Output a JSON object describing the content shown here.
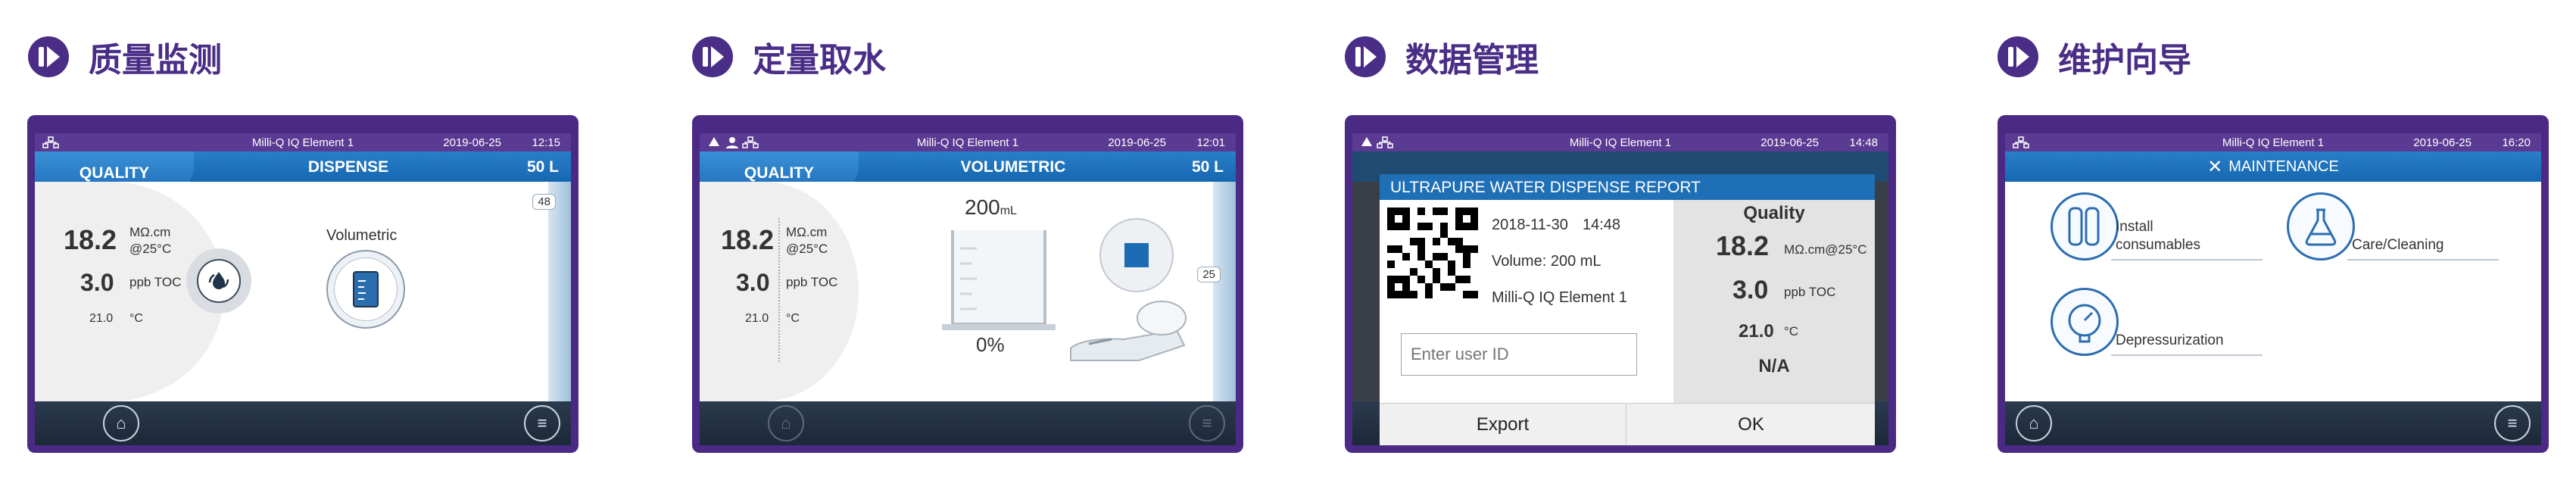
{
  "sections": [
    {
      "title": "质量监测"
    },
    {
      "title": "定量取水"
    },
    {
      "title": "数据管理"
    },
    {
      "title": "维护向导"
    }
  ],
  "status": {
    "device_name": "Milli-Q IQ Element 1",
    "date": "2019-06-25"
  },
  "panel1": {
    "time": "12:15",
    "quality_tab": "QUALITY",
    "mode": "DISPENSE",
    "volume": "50 L",
    "resistivity": "18.2",
    "resistivity_unit": "MΩ.cm",
    "resistivity_temp": "@25°C",
    "toc": "3.0",
    "toc_unit": "ppb TOC",
    "temperature": "21.0",
    "temp_unit": "°C",
    "volumetric_label": "Volumetric",
    "scale_label": "48"
  },
  "panel2": {
    "time": "12:01",
    "quality_tab": "QUALITY",
    "mode": "VOLUMETRIC",
    "volume": "50 L",
    "resistivity": "18.2",
    "resistivity_unit": "MΩ.cm",
    "resistivity_temp": "@25°C",
    "toc": "3.0",
    "toc_unit": "ppb TOC",
    "temperature": "21.0",
    "temp_unit": "°C",
    "target_volume": "200",
    "target_unit": "mL",
    "progress": "0%",
    "progress_value": 0,
    "scale_label": "25"
  },
  "panel3": {
    "time": "14:48",
    "report_title": "ULTRAPURE WATER DISPENSE REPORT",
    "report_date": "2018-11-30",
    "report_time": "14:48",
    "report_volume": "Volume: 200 mL",
    "report_device": "Milli-Q IQ Element 1",
    "user_placeholder": "Enter user ID",
    "quality_heading": "Quality",
    "resistivity": "18.2",
    "resistivity_unit": "MΩ.cm@25°C",
    "toc": "3.0",
    "toc_unit": "ppb TOC",
    "temperature": "21.0",
    "temp_unit": "°C",
    "na_label": "N/A",
    "export_label": "Export",
    "ok_label": "OK"
  },
  "panel4": {
    "time": "16:20",
    "title": "MAINTENANCE",
    "install_label_1": "Install",
    "install_label_2": "consumables",
    "care_label": "Care/Cleaning",
    "depress_label": "Depressurization"
  },
  "colors": {
    "brand_purple": "#4a2d86",
    "header_blue": "#1f6fb6",
    "bottom_bar": "#1f2c3d"
  },
  "icons": [
    "network-icon",
    "water-drop-icon",
    "user-icon",
    "home-icon",
    "menu-icon",
    "dispense-icon",
    "volumetric-icon",
    "stop-icon",
    "qr-code-icon",
    "tools-icon",
    "cartridge-icon",
    "cleaning-flask-icon",
    "pressure-gauge-icon"
  ]
}
